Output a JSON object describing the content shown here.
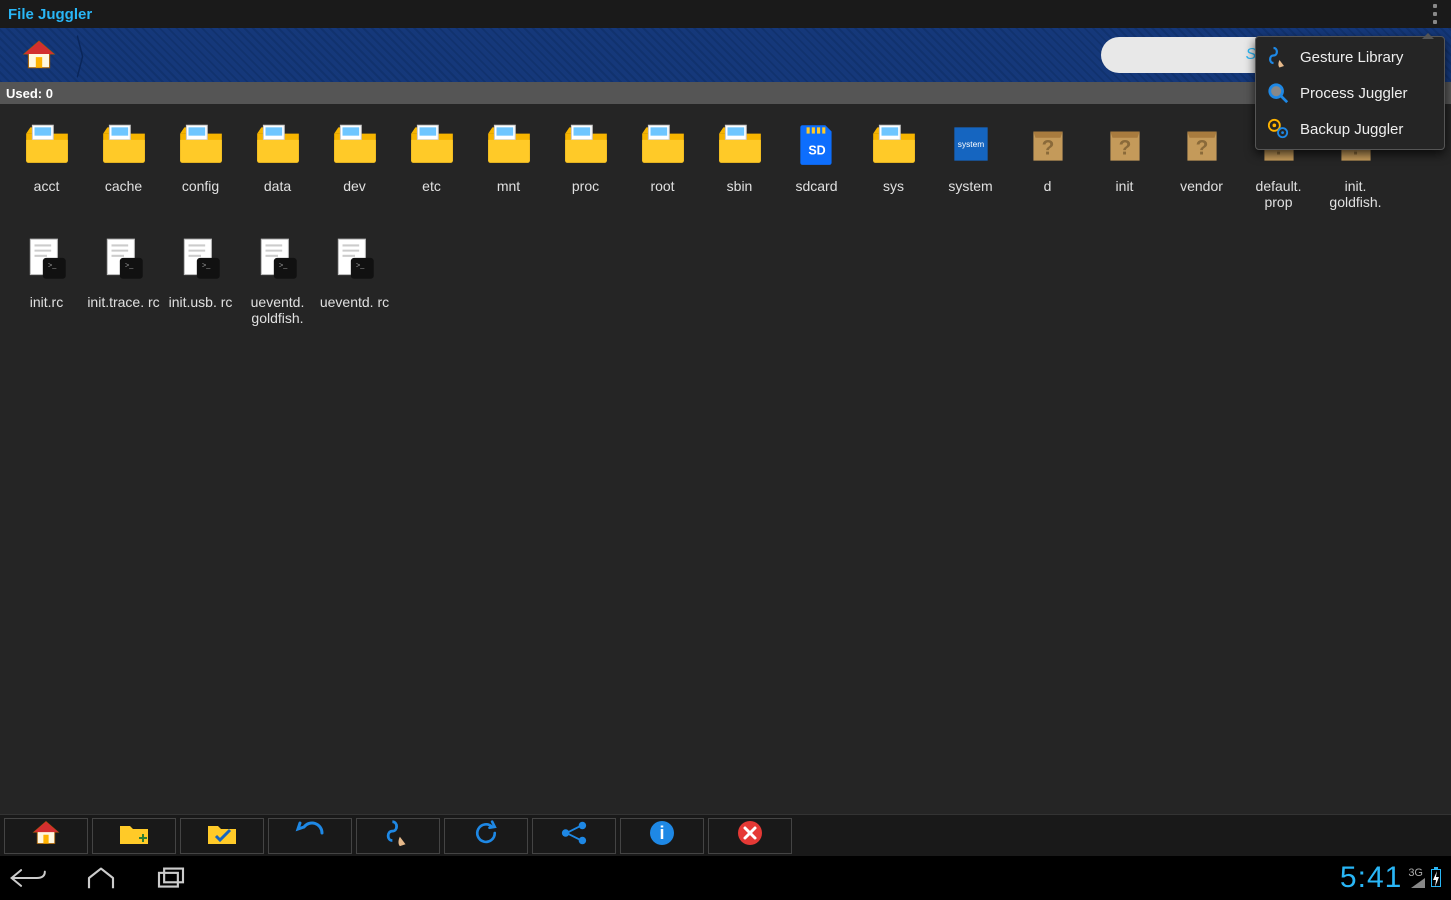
{
  "app": {
    "title": "File Juggler"
  },
  "breadcrumb": {
    "search_placeholder": "Search"
  },
  "used_bar": {
    "label": "Used: 0"
  },
  "files": [
    {
      "name": "acct",
      "icon": "folder"
    },
    {
      "name": "cache",
      "icon": "folder"
    },
    {
      "name": "config",
      "icon": "folder"
    },
    {
      "name": "data",
      "icon": "folder"
    },
    {
      "name": "dev",
      "icon": "folder"
    },
    {
      "name": "etc",
      "icon": "folder"
    },
    {
      "name": "mnt",
      "icon": "folder"
    },
    {
      "name": "proc",
      "icon": "folder"
    },
    {
      "name": "root",
      "icon": "folder"
    },
    {
      "name": "sbin",
      "icon": "folder"
    },
    {
      "name": "sdcard",
      "icon": "sdcard"
    },
    {
      "name": "sys",
      "icon": "folder"
    },
    {
      "name": "system",
      "icon": "system"
    },
    {
      "name": "d",
      "icon": "unknown"
    },
    {
      "name": "init",
      "icon": "unknown"
    },
    {
      "name": "vendor",
      "icon": "unknown"
    },
    {
      "name": "default. prop",
      "icon": "unknown"
    },
    {
      "name": "init. goldfish.",
      "icon": "unknown"
    },
    {
      "name": "init.rc",
      "icon": "script"
    },
    {
      "name": "init.trace. rc",
      "icon": "script"
    },
    {
      "name": "init.usb. rc",
      "icon": "script"
    },
    {
      "name": "ueventd. goldfish.",
      "icon": "script"
    },
    {
      "name": "ueventd. rc",
      "icon": "script"
    }
  ],
  "overflow_menu": {
    "items": [
      {
        "label": "Gesture Library",
        "icon": "gesture"
      },
      {
        "label": "Process Juggler",
        "icon": "process"
      },
      {
        "label": "Backup Juggler",
        "icon": "backup"
      }
    ]
  },
  "toolbar": {
    "buttons": [
      {
        "name": "home",
        "icon": "home"
      },
      {
        "name": "new-folder",
        "icon": "newfolder"
      },
      {
        "name": "select",
        "icon": "folder-check"
      },
      {
        "name": "undo",
        "icon": "undo"
      },
      {
        "name": "gesture",
        "icon": "gesture"
      },
      {
        "name": "refresh",
        "icon": "refresh"
      },
      {
        "name": "share",
        "icon": "share"
      },
      {
        "name": "info",
        "icon": "info"
      },
      {
        "name": "close",
        "icon": "close"
      }
    ]
  },
  "sysbar": {
    "time": "5:41",
    "net": "3G"
  }
}
